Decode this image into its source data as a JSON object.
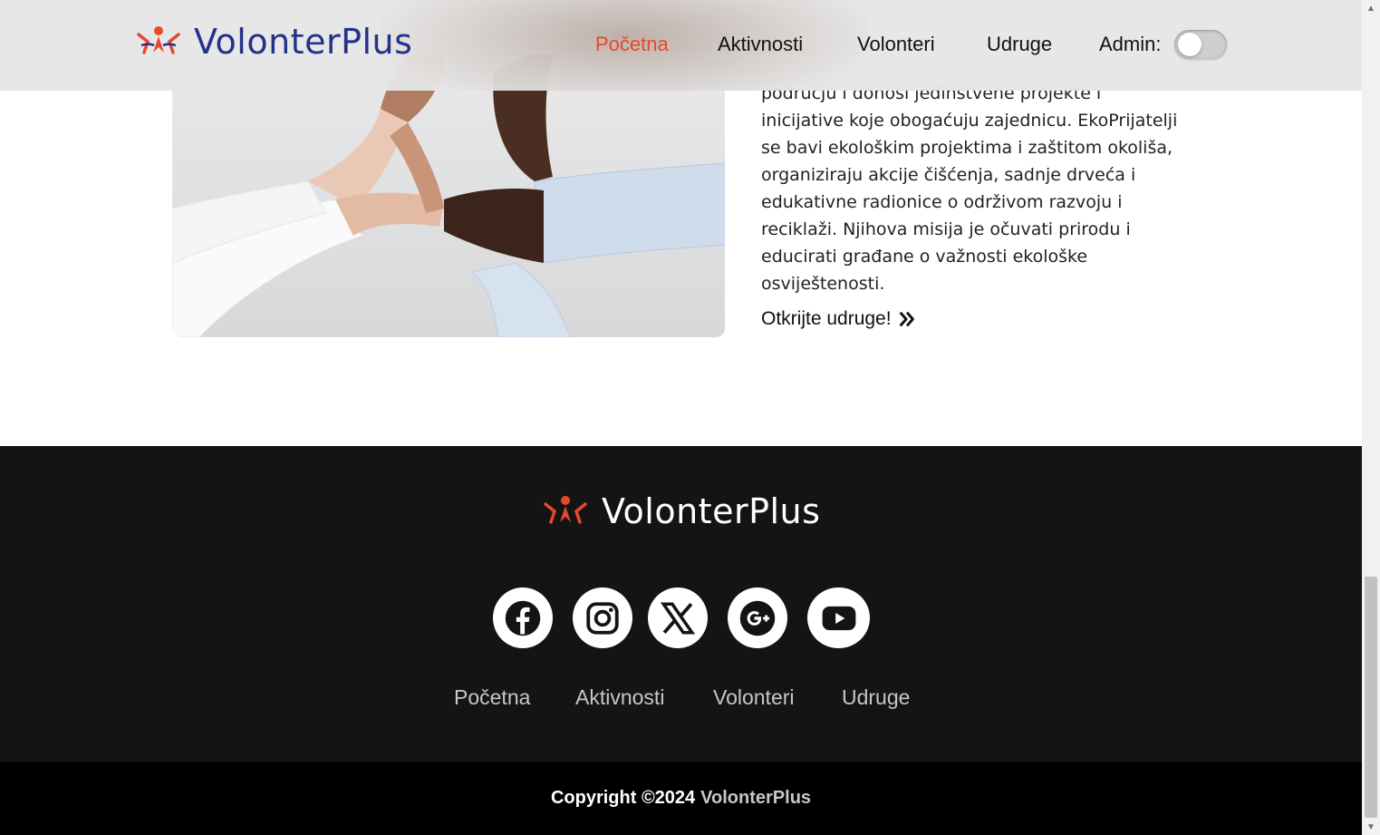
{
  "header": {
    "logo_text": "VolonterPlus",
    "nav": [
      {
        "label": "Početna",
        "active": true
      },
      {
        "label": "Aktivnosti",
        "active": false
      },
      {
        "label": "Volonteri",
        "active": false
      },
      {
        "label": "Udruge",
        "active": false
      }
    ],
    "admin_label": "Admin:",
    "admin_toggle_on": false
  },
  "main": {
    "image_alt": "hands-holding-image",
    "paragraph": "području i donosi jedinstvene projekte i inicijative koje obogaćuju zajednicu. EkoPrijatelji se bavi ekološkim projektima i zaštitom okoliša, organiziraju akcije čišćenja, sadnje drveća i edukativne radionice o održivom razvoju i reciklaži. Njihova misija je očuvati prirodu i educirati građane o važnosti ekološke osviještenosti.",
    "cta_label": "Otkrijte udruge!"
  },
  "footer": {
    "logo_text": "VolonterPlus",
    "social": [
      "facebook-icon",
      "instagram-icon",
      "x-icon",
      "google-plus-icon",
      "youtube-icon"
    ],
    "nav": [
      "Početna",
      "Aktivnosti",
      "Volonteri",
      "Udruge"
    ],
    "copyright_prefix": "Copyright ©2024",
    "copyright_brand": "VolonterPlus"
  },
  "colors": {
    "brand_blue": "#24328a",
    "accent_red": "#e8472d",
    "footer_bg": "#141414"
  }
}
